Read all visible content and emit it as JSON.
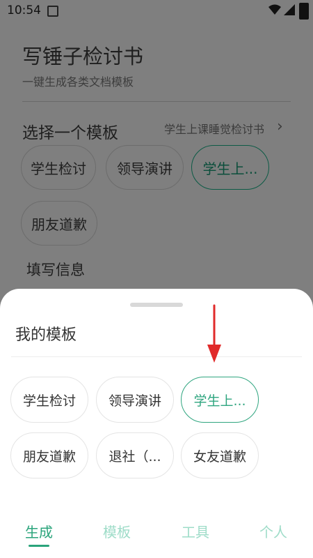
{
  "status_bar": {
    "time": "10:54"
  },
  "app": {
    "title": "写锤子检讨书",
    "subtitle": "一键生成各类文档模板",
    "select_title": "选择一个模板",
    "selected_template_link": "学生上课睡觉检讨书",
    "template_chips": [
      {
        "label": "学生检讨"
      },
      {
        "label": "领导演讲"
      },
      {
        "label": "学生上..."
      },
      {
        "label": "朋友道歉"
      }
    ],
    "fill_info_title": "填写信息"
  },
  "sheet": {
    "title": "我的模板",
    "chips": [
      {
        "label": "学生检讨"
      },
      {
        "label": "领导演讲"
      },
      {
        "label": "学生上..."
      },
      {
        "label": "朋友道歉"
      },
      {
        "label": "退社（..."
      },
      {
        "label": "女友道歉"
      }
    ]
  },
  "tabs": [
    {
      "label": "生成"
    },
    {
      "label": "模板"
    },
    {
      "label": "工具"
    },
    {
      "label": "个人"
    }
  ],
  "colors": {
    "accent": "#2aa47b",
    "overlay": "#7f7f7f",
    "arrow": "#e02a2a"
  }
}
